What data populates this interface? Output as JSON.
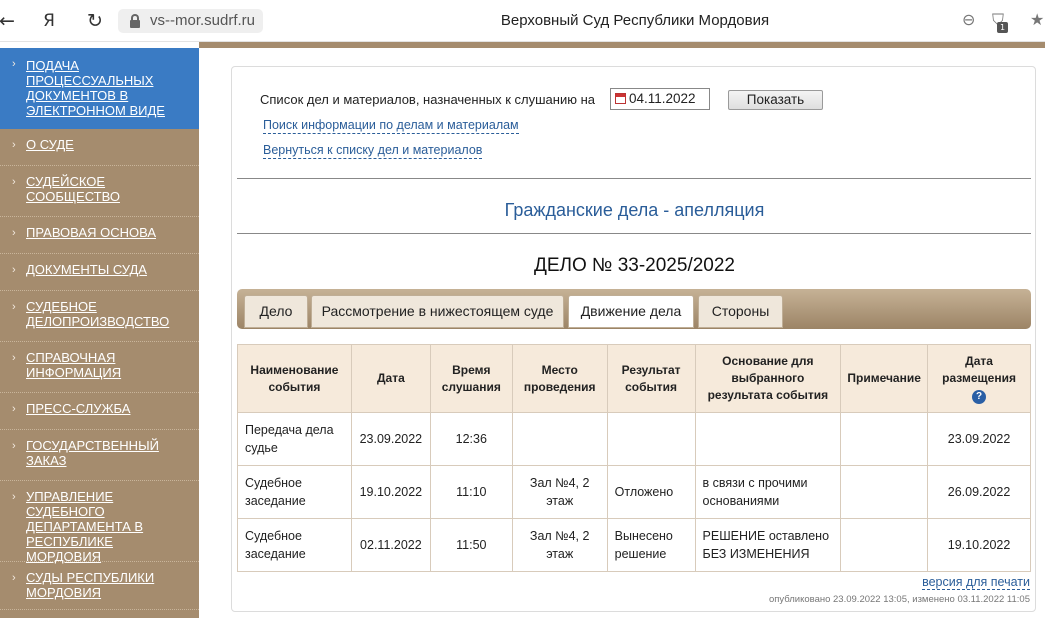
{
  "browser": {
    "url": "vs--mor.sudrf.ru",
    "title": "Верховный Суд Республики Мордовия",
    "ext_badge": "1"
  },
  "sidebar": {
    "items": [
      {
        "label": "Подача процессуальных документов в электронном виде",
        "active": true
      },
      {
        "label": "О суде"
      },
      {
        "label": "Судейское сообщество"
      },
      {
        "label": "Правовая основа"
      },
      {
        "label": "Документы суда"
      },
      {
        "label": "Судебное делопроизводство"
      },
      {
        "label": "Справочная информация"
      },
      {
        "label": "Пресс-служба"
      },
      {
        "label": "Государственный заказ"
      },
      {
        "label": "Управление Судебного департамента в Республике Мордовия"
      },
      {
        "label": "Суды Республики Мордовия"
      }
    ]
  },
  "search": {
    "label": "Список дел и материалов, назначенных к слушанию на",
    "date": "04.11.2022",
    "button": "Показать",
    "link_search": "Поиск информации по делам и материалам",
    "link_back": "Вернуться к списку дел и материалов"
  },
  "section_title": "Гражданские дела - апелляция",
  "case_title": "ДЕЛО № 33-2025/2022",
  "tabs": [
    "Дело",
    "Рассмотрение в нижестоящем суде",
    "Движение дела",
    "Стороны"
  ],
  "active_tab": "Движение дела",
  "table": {
    "headers": [
      "Наименование события",
      "Дата",
      "Время слушания",
      "Место проведения",
      "Результат события",
      "Основание для выбранного результата события",
      "Примечание",
      "Дата размещения"
    ],
    "help_icon": "?",
    "rows": [
      [
        "Передача дела судье",
        "23.09.2022",
        "12:36",
        "",
        "",
        "",
        "",
        "23.09.2022"
      ],
      [
        "Судебное заседание",
        "19.10.2022",
        "11:10",
        "Зал №4, 2 этаж",
        "Отложено",
        "в связи с прочими основаниями",
        "",
        "26.09.2022"
      ],
      [
        "Судебное заседание",
        "02.11.2022",
        "11:50",
        "Зал №4, 2 этаж",
        "Вынесено решение",
        "РЕШЕНИЕ оставлено БЕЗ ИЗМЕНЕНИЯ",
        "",
        "19.10.2022"
      ]
    ]
  },
  "footer": {
    "print": "версия для печати",
    "published": "опубликовано 23.09.2022 13:05, изменено 03.11.2022 11:05"
  }
}
